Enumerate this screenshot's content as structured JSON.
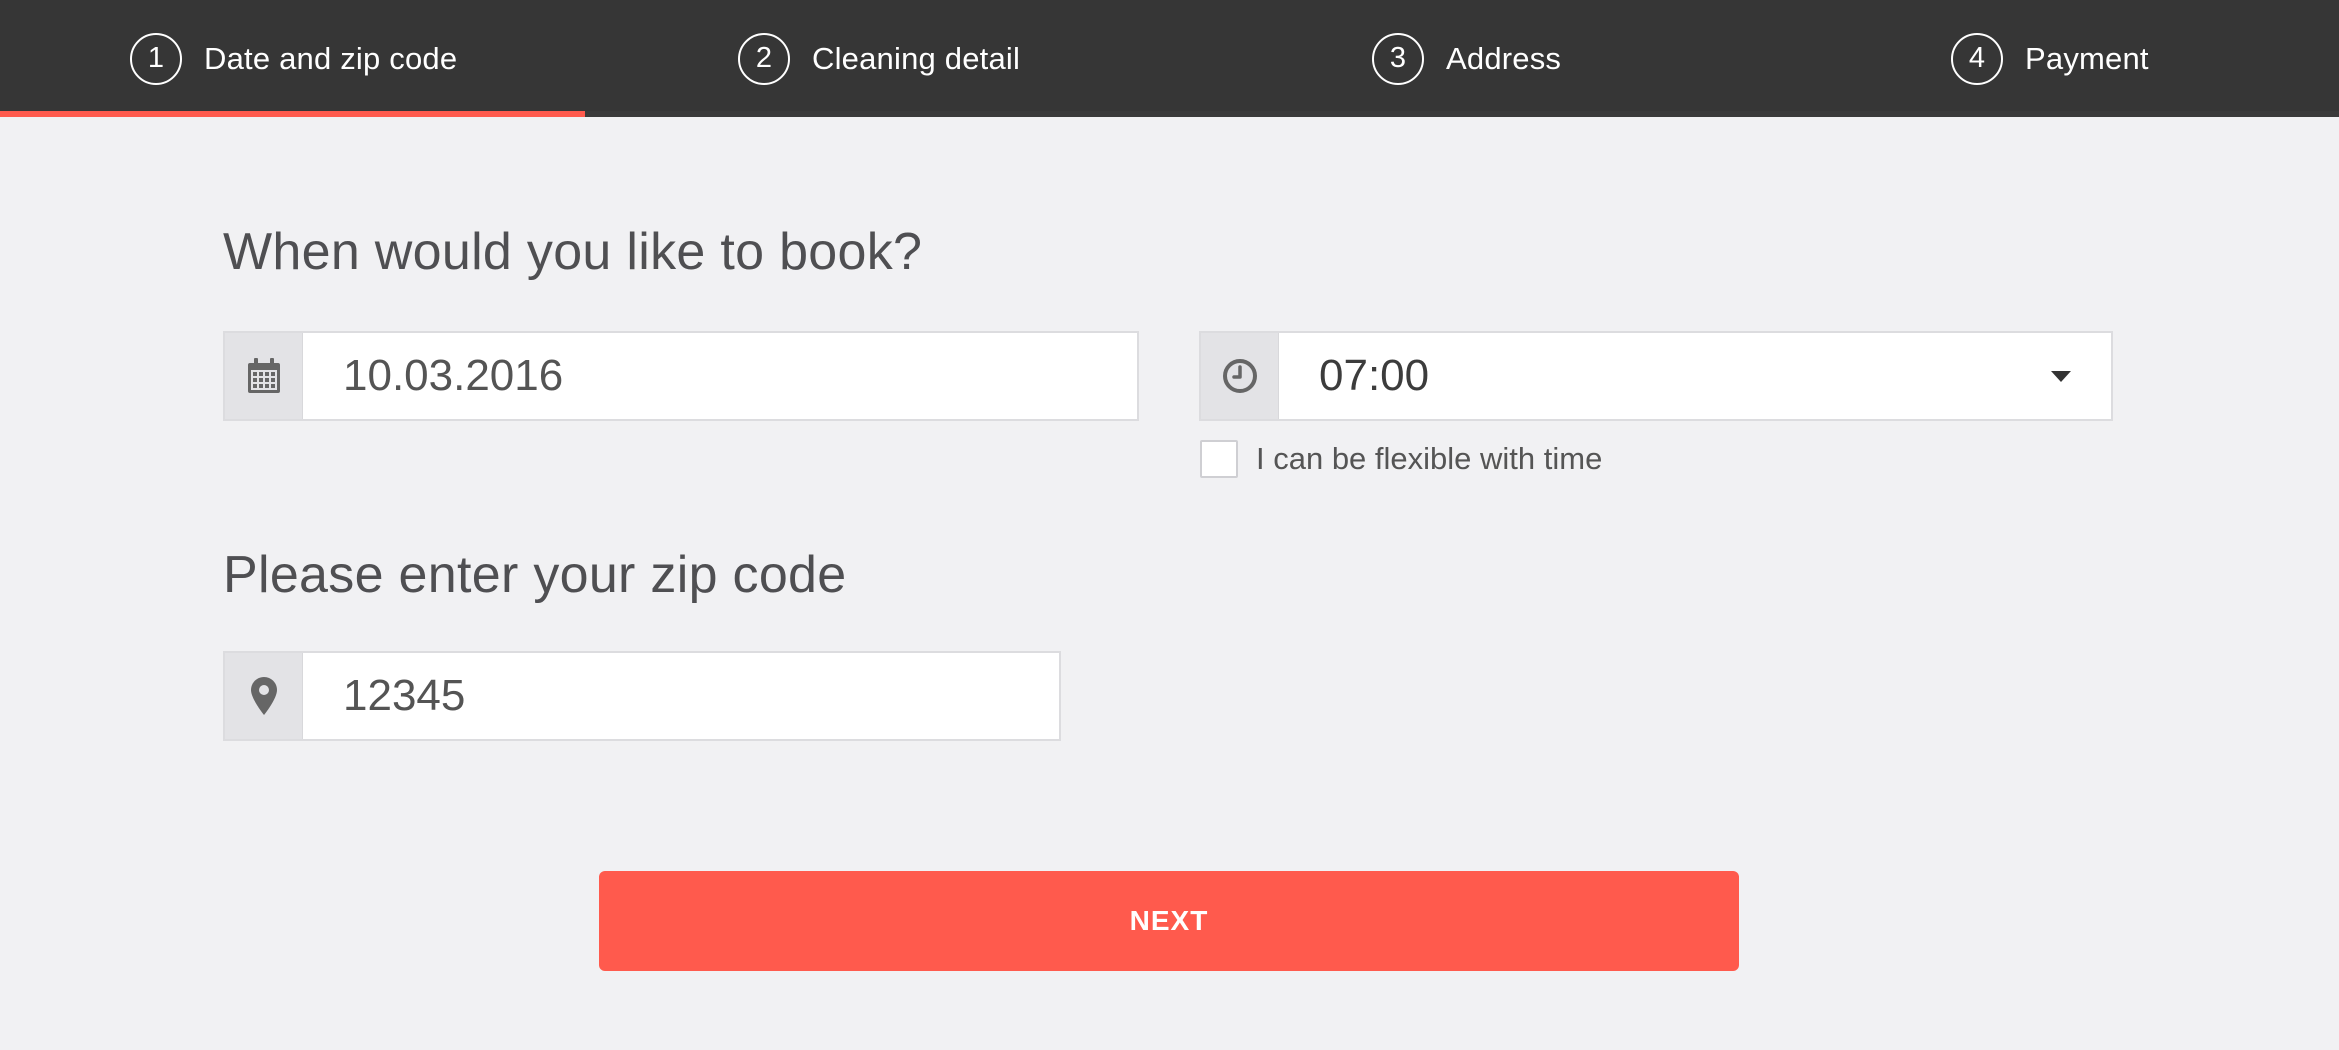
{
  "stepper": {
    "steps": [
      {
        "number": "1",
        "label": "Date and zip code"
      },
      {
        "number": "2",
        "label": "Cleaning detail"
      },
      {
        "number": "3",
        "label": "Address"
      },
      {
        "number": "4",
        "label": "Payment"
      }
    ],
    "progress_fraction": 0.25,
    "progress_color": "#ff5a4d"
  },
  "booking": {
    "heading": "When would you like to book?",
    "date_value": "10.03.2016",
    "date_icon": "calendar-icon",
    "time_value": "07:00",
    "time_icon": "clock-icon",
    "flexible_label": "I can be flexible with time",
    "flexible_checked": false
  },
  "zip": {
    "heading": "Please enter your zip code",
    "value": "12345",
    "icon": "map-pin-icon"
  },
  "actions": {
    "next_label": "NEXT",
    "accent_color": "#ff5a4d"
  }
}
